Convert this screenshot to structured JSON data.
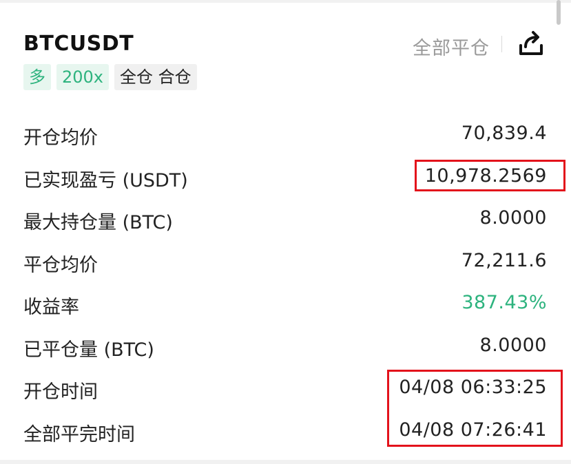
{
  "header": {
    "symbol": "BTCUSDT",
    "close_all_label": "全部平仓",
    "share_icon": "share-icon"
  },
  "tags": [
    {
      "label": "多",
      "style": "green"
    },
    {
      "label": "200x",
      "style": "green"
    },
    {
      "label": "全仓 合仓",
      "style": "gray"
    }
  ],
  "details": [
    {
      "label": "开仓均价",
      "value": "70,839.4"
    },
    {
      "label": "已实现盈亏 (USDT)",
      "value": "10,978.2569"
    },
    {
      "label": "最大持仓量 (BTC)",
      "value": "8.0000"
    },
    {
      "label": "平仓均价",
      "value": "72,211.6"
    },
    {
      "label": "收益率",
      "value": "387.43%"
    },
    {
      "label": "已平仓量 (BTC)",
      "value": "8.0000"
    },
    {
      "label": "开仓时间",
      "value": "04/08 06:33:25"
    },
    {
      "label": "全部平完时间",
      "value": "04/08 07:26:41"
    }
  ],
  "colors": {
    "positive": "#2db37e",
    "highlight_box": "#e3121b",
    "muted": "#9a9a9a"
  }
}
